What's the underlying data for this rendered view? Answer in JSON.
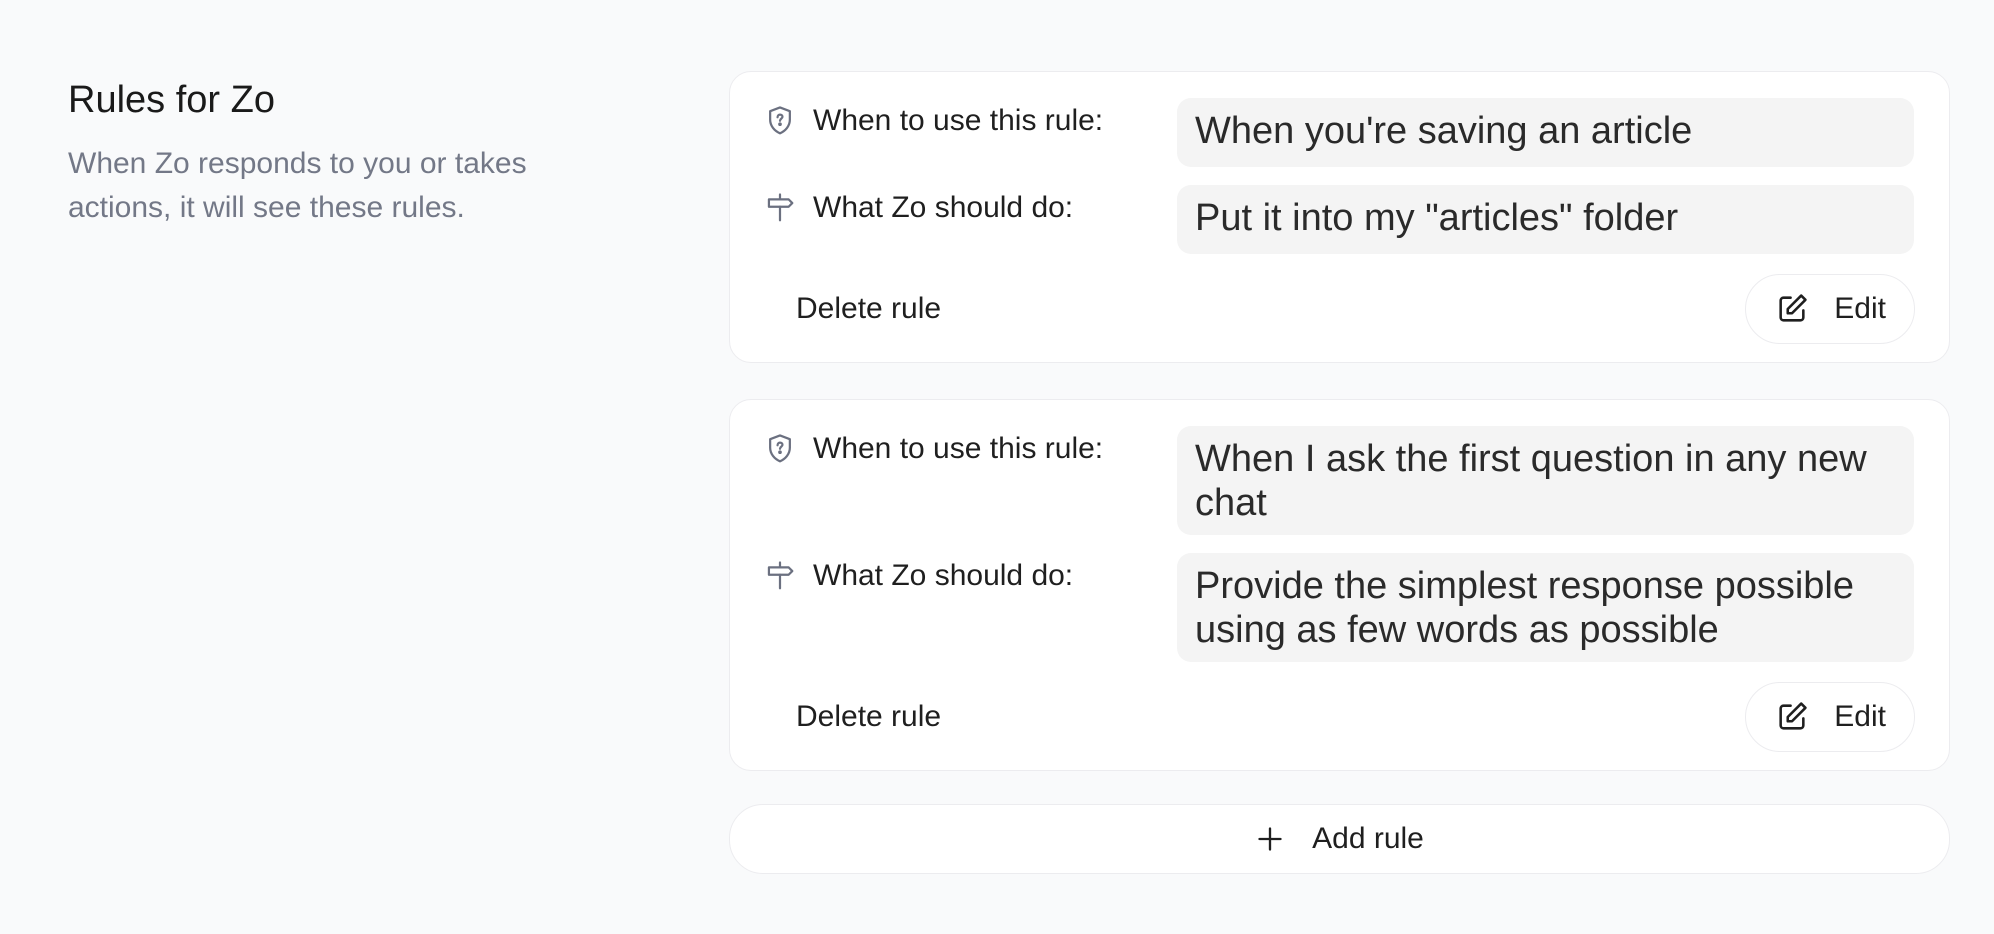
{
  "header": {
    "title": "Rules for Zo",
    "description": "When Zo responds to you or takes actions, it will see these rules."
  },
  "labels": {
    "when": "When to use this rule:",
    "what": "What Zo should do:",
    "delete": "Delete rule",
    "edit": "Edit",
    "add": "Add rule"
  },
  "rules": [
    {
      "when": "When you're saving an article",
      "what": "Put it into my \"articles\" folder"
    },
    {
      "when": "When I ask the first question in any new chat",
      "what": "Provide the simplest response possible using as few words as possible"
    }
  ],
  "icons": {
    "when": "shield-question-icon",
    "what": "signpost-icon",
    "edit": "pencil-square-icon",
    "add": "plus-icon"
  }
}
